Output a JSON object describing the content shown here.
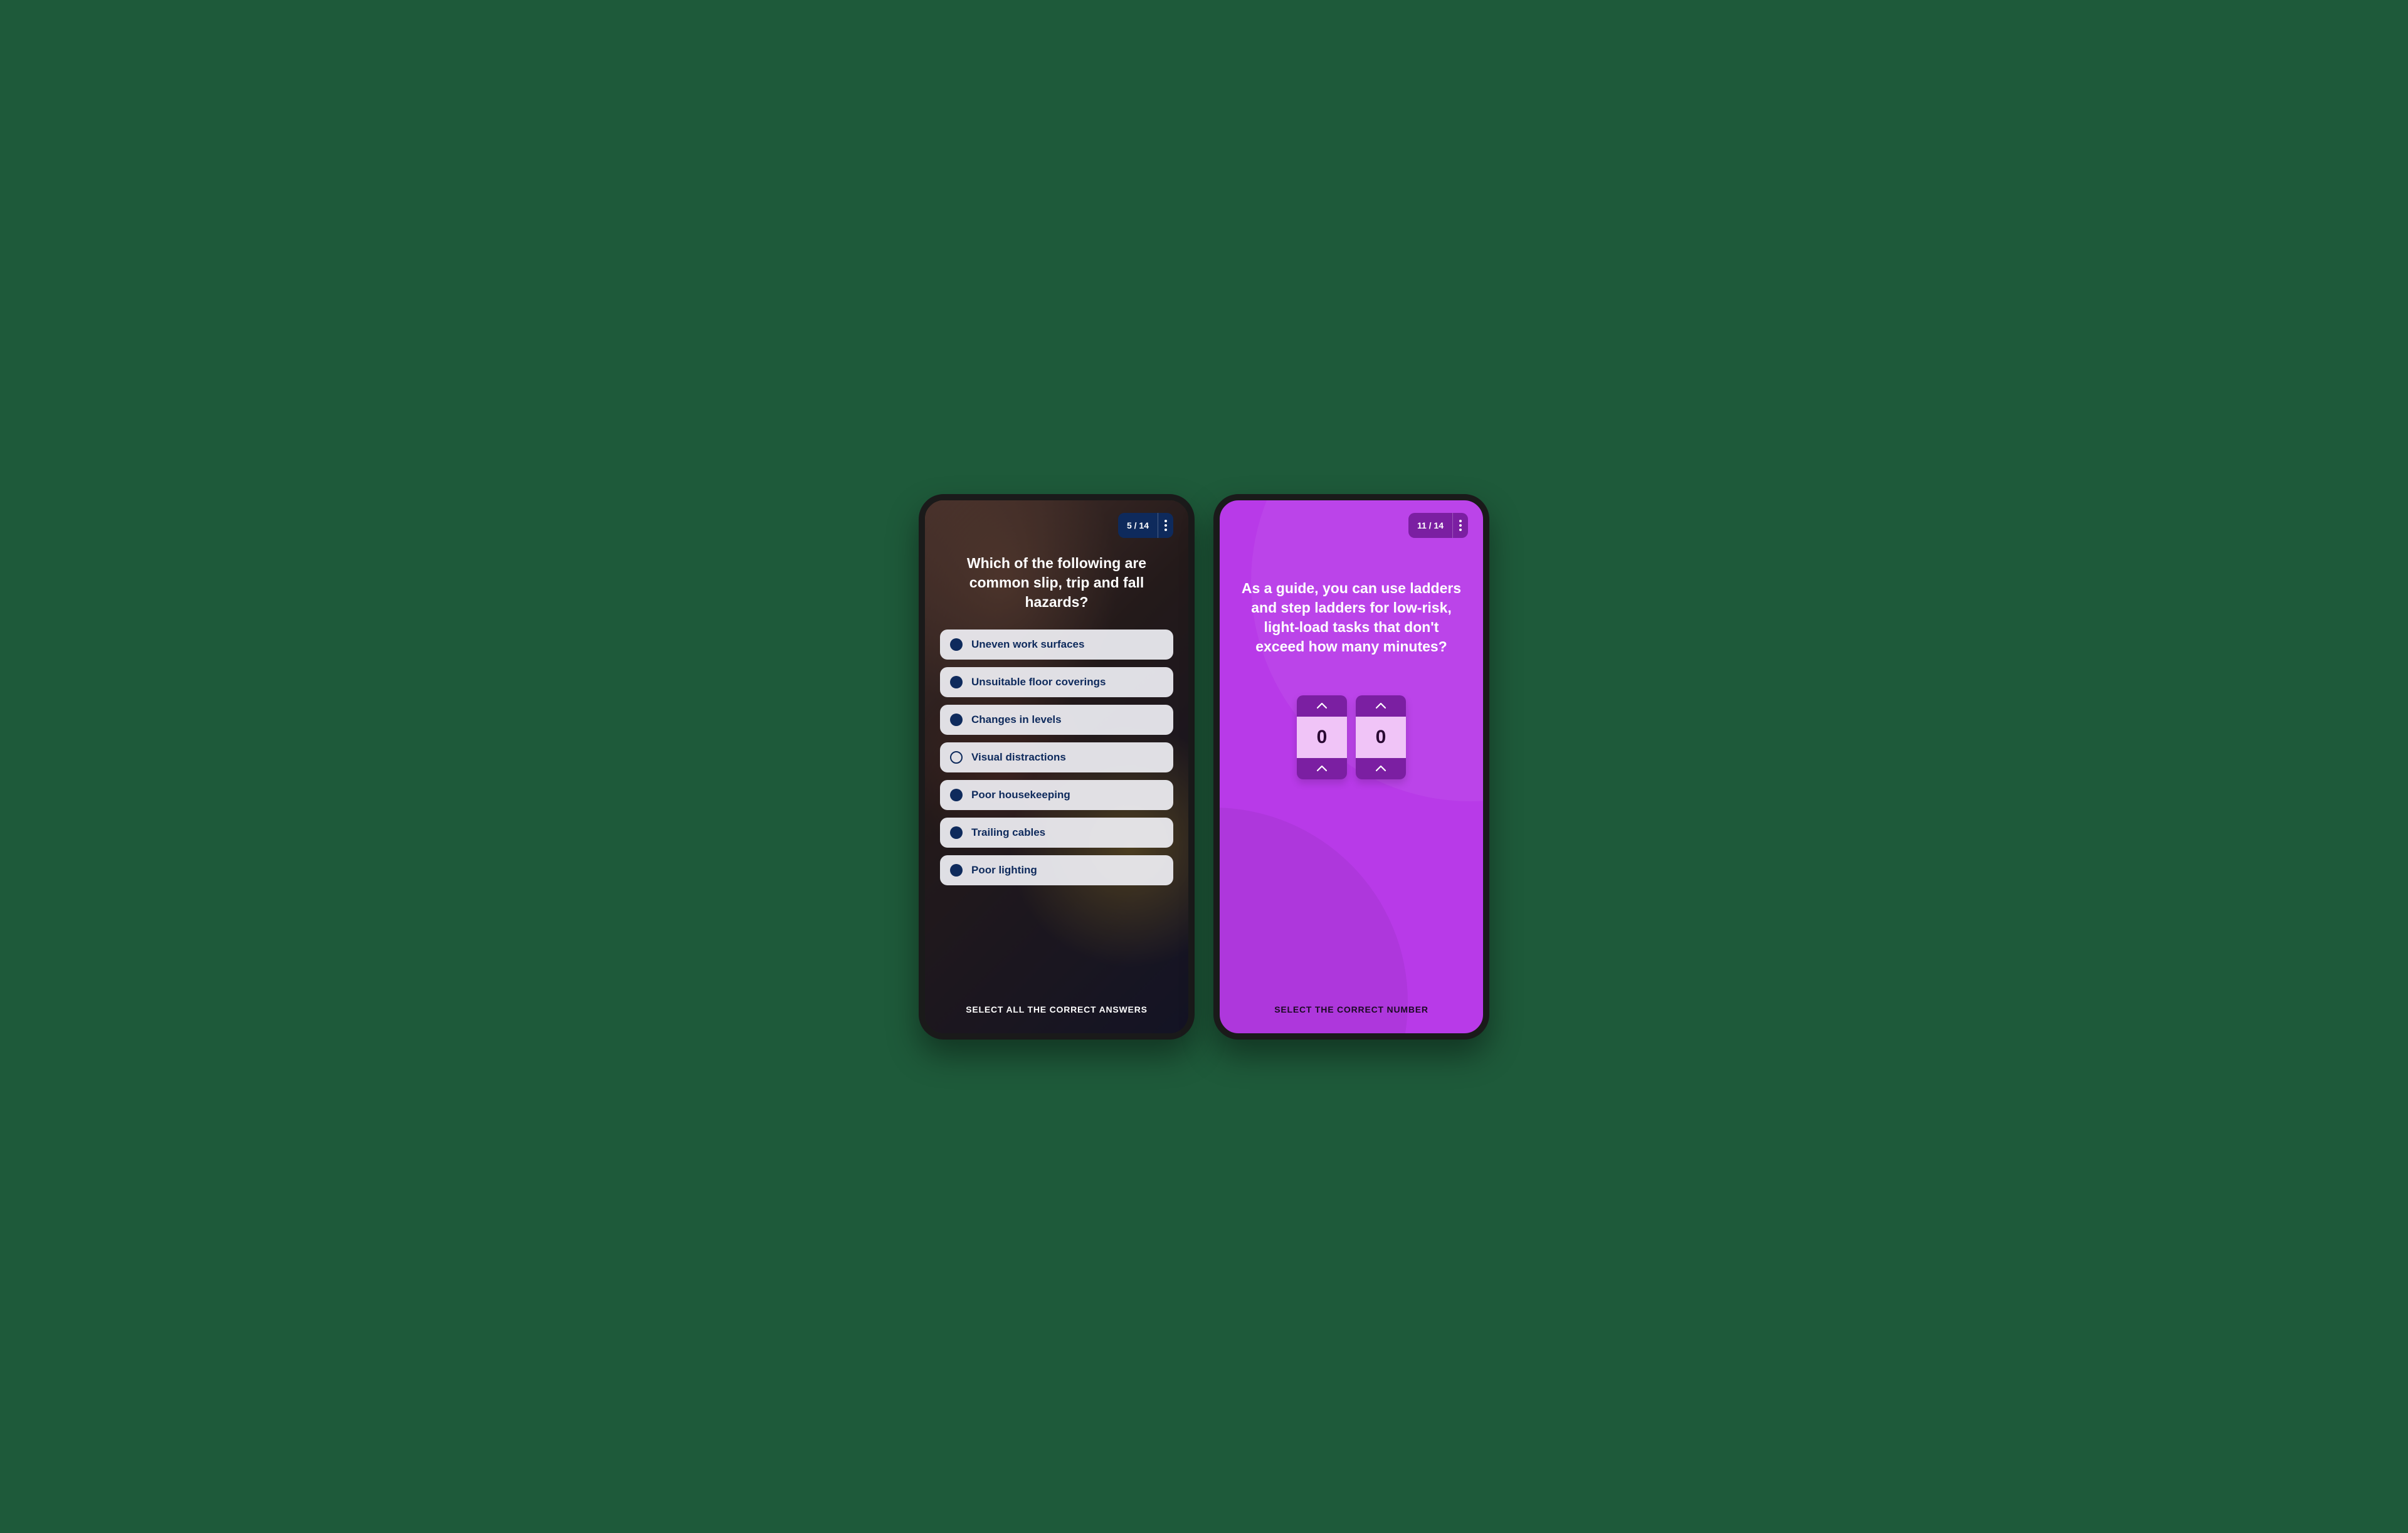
{
  "phone1": {
    "progress": "5 / 14",
    "question": "Which of the following are common slip, trip and fall hazards?",
    "options": [
      {
        "label": "Uneven work surfaces",
        "selected": true
      },
      {
        "label": "Unsuitable floor coverings",
        "selected": true
      },
      {
        "label": "Changes in levels",
        "selected": true
      },
      {
        "label": "Visual distractions",
        "selected": false
      },
      {
        "label": "Poor housekeeping",
        "selected": true
      },
      {
        "label": "Trailing cables",
        "selected": true
      },
      {
        "label": "Poor lighting",
        "selected": true
      }
    ],
    "instruction": "SELECT ALL THE CORRECT ANSWERS"
  },
  "phone2": {
    "progress": "11 / 14",
    "question": "As a guide, you can use ladders and step ladders for low-risk, light-load tasks that don't exceed how many minutes?",
    "digits": [
      "0",
      "0"
    ],
    "instruction": "SELECT THE CORRECT NUMBER"
  }
}
